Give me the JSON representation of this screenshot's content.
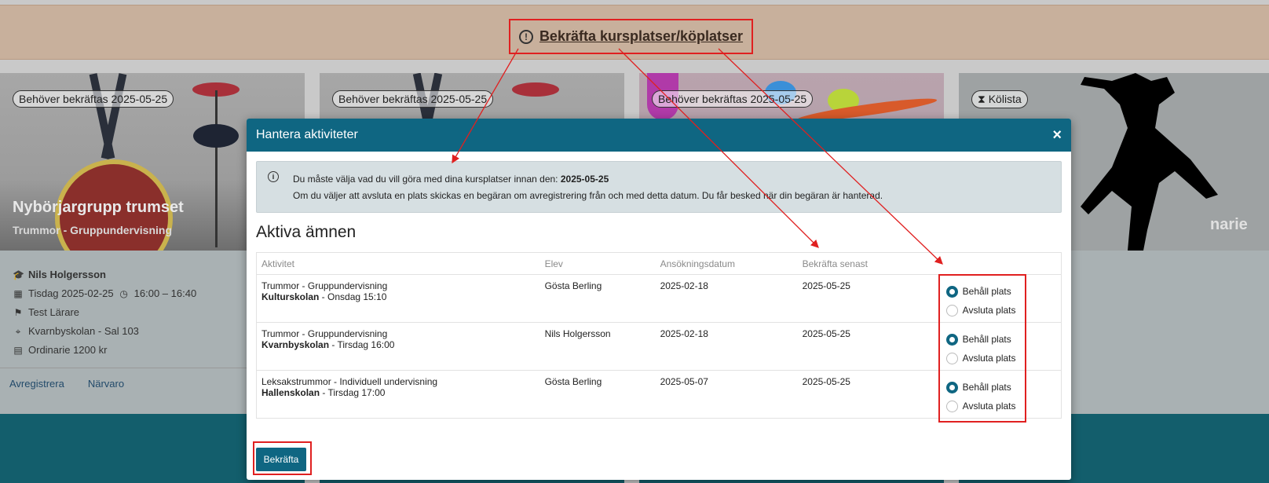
{
  "banner": {
    "icon": "exclamation-circle-icon",
    "link_label": "Bekräfta kursplatser/köplatser"
  },
  "cards": [
    {
      "badge": "Behöver bekräftas 2025-05-25",
      "title": "Nybörjargrupp trumset",
      "subtitle": "Trummor - Gruppundervisning",
      "student": "Nils Holgersson",
      "date": "Tisdag 2025-02-25",
      "time": "16:00 – 16:40",
      "teacher": "Test Lärare",
      "location": "Kvarnbyskolan - Sal 103",
      "price": "Ordinarie 1200 kr",
      "links": [
        "Avregistrera",
        "Närvaro"
      ]
    },
    {
      "badge": "Behöver bekräftas 2025-05-25"
    },
    {
      "badge": "Behöver bekräftas 2025-05-25"
    },
    {
      "badge": "Kölista",
      "title_fragment": "narie"
    }
  ],
  "modal": {
    "title": "Hantera aktiviteter",
    "close_icon": "close-icon",
    "alert": {
      "icon": "info-circle-icon",
      "line1_prefix": "Du måste välja vad du vill göra med dina kursplatser innan den: ",
      "line1_date": "2025-05-25",
      "line2": "Om du väljer att avsluta en plats skickas en begäran om avregistrering från och med detta datum. Du får besked när din begäran är hanterad."
    },
    "section_title": "Aktiva ämnen",
    "columns": [
      "Aktivitet",
      "Elev",
      "Ansökningsdatum",
      "Bekräfta senast",
      ""
    ],
    "rows": [
      {
        "activity": "Trummor - Gruppundervisning",
        "school": "Kulturskolan",
        "schedule": " - Onsdag 15:10",
        "student": "Gösta Berling",
        "applied": "2025-02-18",
        "deadline": "2025-05-25",
        "keep_label": "Behåll plats",
        "end_label": "Avsluta plats",
        "selected": "keep"
      },
      {
        "activity": "Trummor - Gruppundervisning",
        "school": "Kvarnbyskolan",
        "schedule": " - Tirsdag 16:00",
        "student": "Nils Holgersson",
        "applied": "2025-02-18",
        "deadline": "2025-05-25",
        "keep_label": "Behåll plats",
        "end_label": "Avsluta plats",
        "selected": "keep"
      },
      {
        "activity": "Leksakstrummor - Individuell undervisning",
        "school": "Hallenskolan",
        "schedule": " - Tirsdag 17:00",
        "student": "Gösta Berling",
        "applied": "2025-05-07",
        "deadline": "2025-05-25",
        "keep_label": "Behåll plats",
        "end_label": "Avsluta plats",
        "selected": "keep"
      }
    ],
    "confirm_label": "Bekräfta"
  },
  "colors": {
    "primary": "#0f6682",
    "annotation_red": "#e02020",
    "banner_bg": "#c8b09c"
  }
}
